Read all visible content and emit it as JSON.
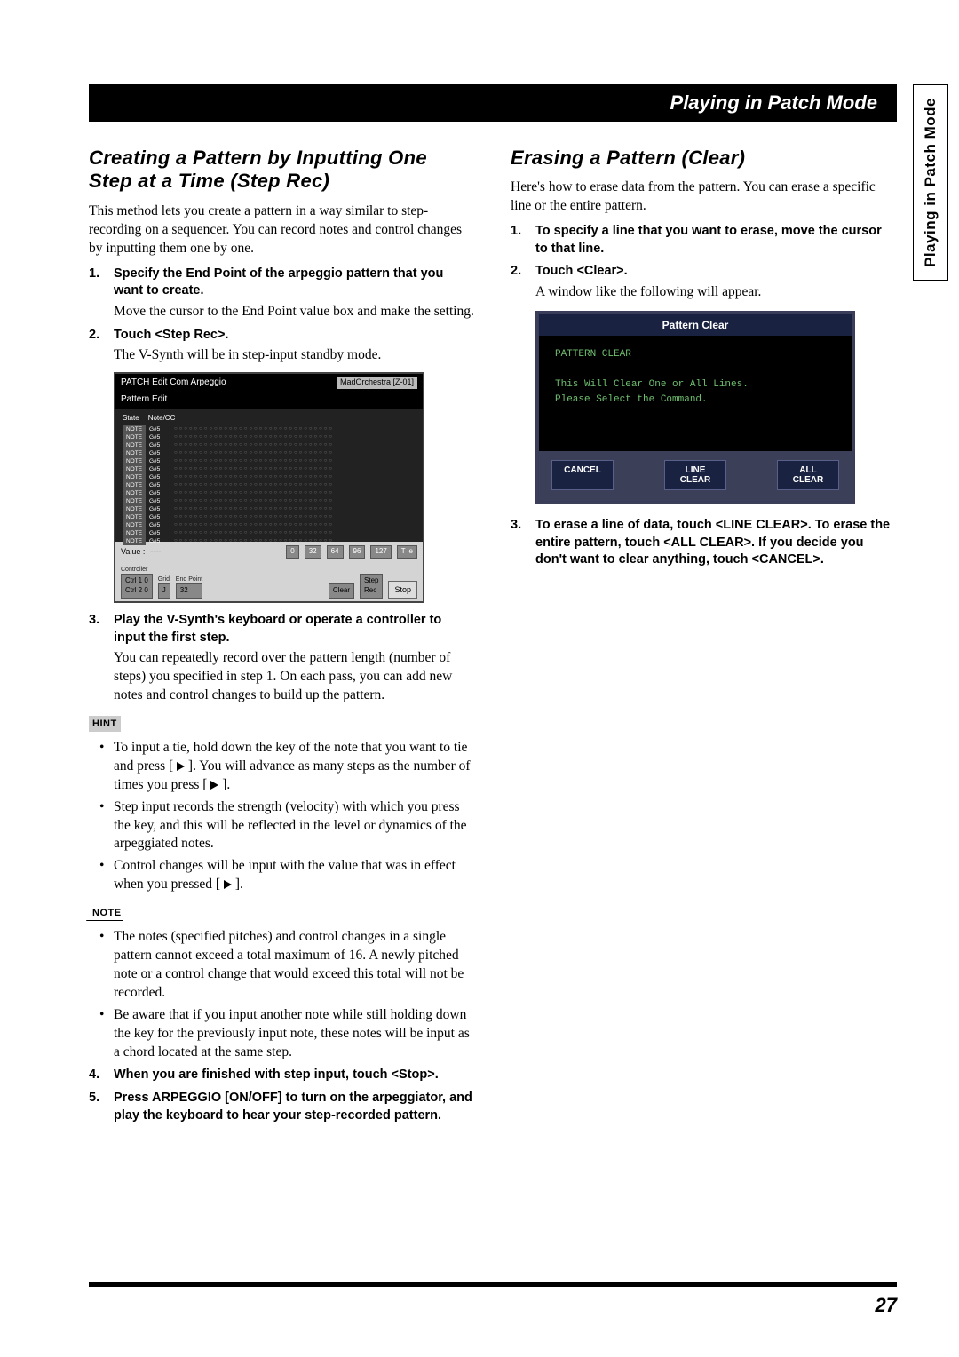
{
  "header": {
    "title": "Playing in Patch Mode"
  },
  "side_tab": {
    "label": "Playing in Patch Mode"
  },
  "left": {
    "heading": "Creating a Pattern by Inputting One Step at a Time (Step Rec)",
    "intro": "This method lets you create a pattern in a way similar to step-recording on a sequencer. You can record notes and control changes by inputting them one by one.",
    "steps": [
      {
        "num": "1.",
        "title": "Specify the End Point of the arpeggio pattern that you want to create.",
        "body": "Move the cursor to the End Point value box and make the setting."
      },
      {
        "num": "2.",
        "title": "Touch <Step Rec>.",
        "body": "The V-Synth will be in step-input standby mode."
      },
      {
        "num": "3.",
        "title": "Play the V-Synth's keyboard or operate a controller to input the first step.",
        "body": "You can repeatedly record over the pattern length (number of steps) you specified in step 1. On each pass, you can add new notes and control changes to build up the pattern."
      }
    ],
    "hint_label": "HINT",
    "hints": [
      "To input a tie, hold down the key of the note that you want to tie and press [ ▶ ]. You will advance as many steps as the number of times you press [ ▶ ].",
      "Step input records the strength (velocity) with which you press the key, and this will be reflected in the level or dynamics of the arpeggiated notes.",
      "Control changes will be input with the value that was in effect when you pressed [ ▶ ]."
    ],
    "note_label": "NOTE",
    "notes": [
      "The notes (specified pitches) and control changes in a single pattern cannot exceed a total maximum of 16. A newly pitched note or a control change that would exceed this total will not be recorded.",
      "Be aware that if you input another note while still holding down the key for the previously input note, these notes will be input as a chord located at the same step."
    ],
    "step4": {
      "num": "4.",
      "title": "When you are finished with step input, touch <Stop>."
    },
    "step5": {
      "num": "5.",
      "title": "Press ARPEGGIO [ON/OFF] to turn on the arpeggiator, and play the keyboard to hear your step-recorded pattern."
    },
    "ss1": {
      "titlebar_left": "PATCH Edit Com Arpeggio",
      "titlebar_right": "MadOrchestra [Z-01]",
      "sub": "Pattern Edit",
      "gridhead_state": "State",
      "gridhead_note": "Note/CC",
      "row_state": "NOTE",
      "row_note": "G#5",
      "value_label": "Value :",
      "value_dashes": "----",
      "btns": [
        "0",
        "32",
        "64",
        "96",
        "127",
        "T ie"
      ],
      "controller_label": "Controller",
      "grid_label": "Grid",
      "endpoint_label": "End Point",
      "ctrl1": "Ctrl 1        0",
      "ctrl2": "Ctrl 2        0",
      "grid_val": "J",
      "endpoint_val": "32",
      "clear": "Clear",
      "steprec": "Step\nRec",
      "stop": "Stop"
    }
  },
  "right": {
    "heading": "Erasing a Pattern (Clear)",
    "intro": "Here's how to erase data from the pattern. You can erase a specific line or the entire pattern.",
    "steps": [
      {
        "num": "1.",
        "title": "To specify a line that you want to erase, move the cursor to that line."
      },
      {
        "num": "2.",
        "title": "Touch <Clear>.",
        "body": "A window like the following will appear."
      }
    ],
    "step3": {
      "num": "3.",
      "title": "To erase a line of data, touch <LINE CLEAR>. To erase the entire pattern, touch <ALL CLEAR>. If you decide you don't want to clear anything, touch <CANCEL>."
    },
    "ss2": {
      "title": "Pattern Clear",
      "line1": "PATTERN CLEAR",
      "line2": "This Will Clear One or All Lines.",
      "line3": "Please Select the Command.",
      "btn_cancel": "CANCEL",
      "btn_line": "LINE\nCLEAR",
      "btn_all": "ALL\nCLEAR"
    }
  },
  "footer": {
    "page": "27"
  }
}
